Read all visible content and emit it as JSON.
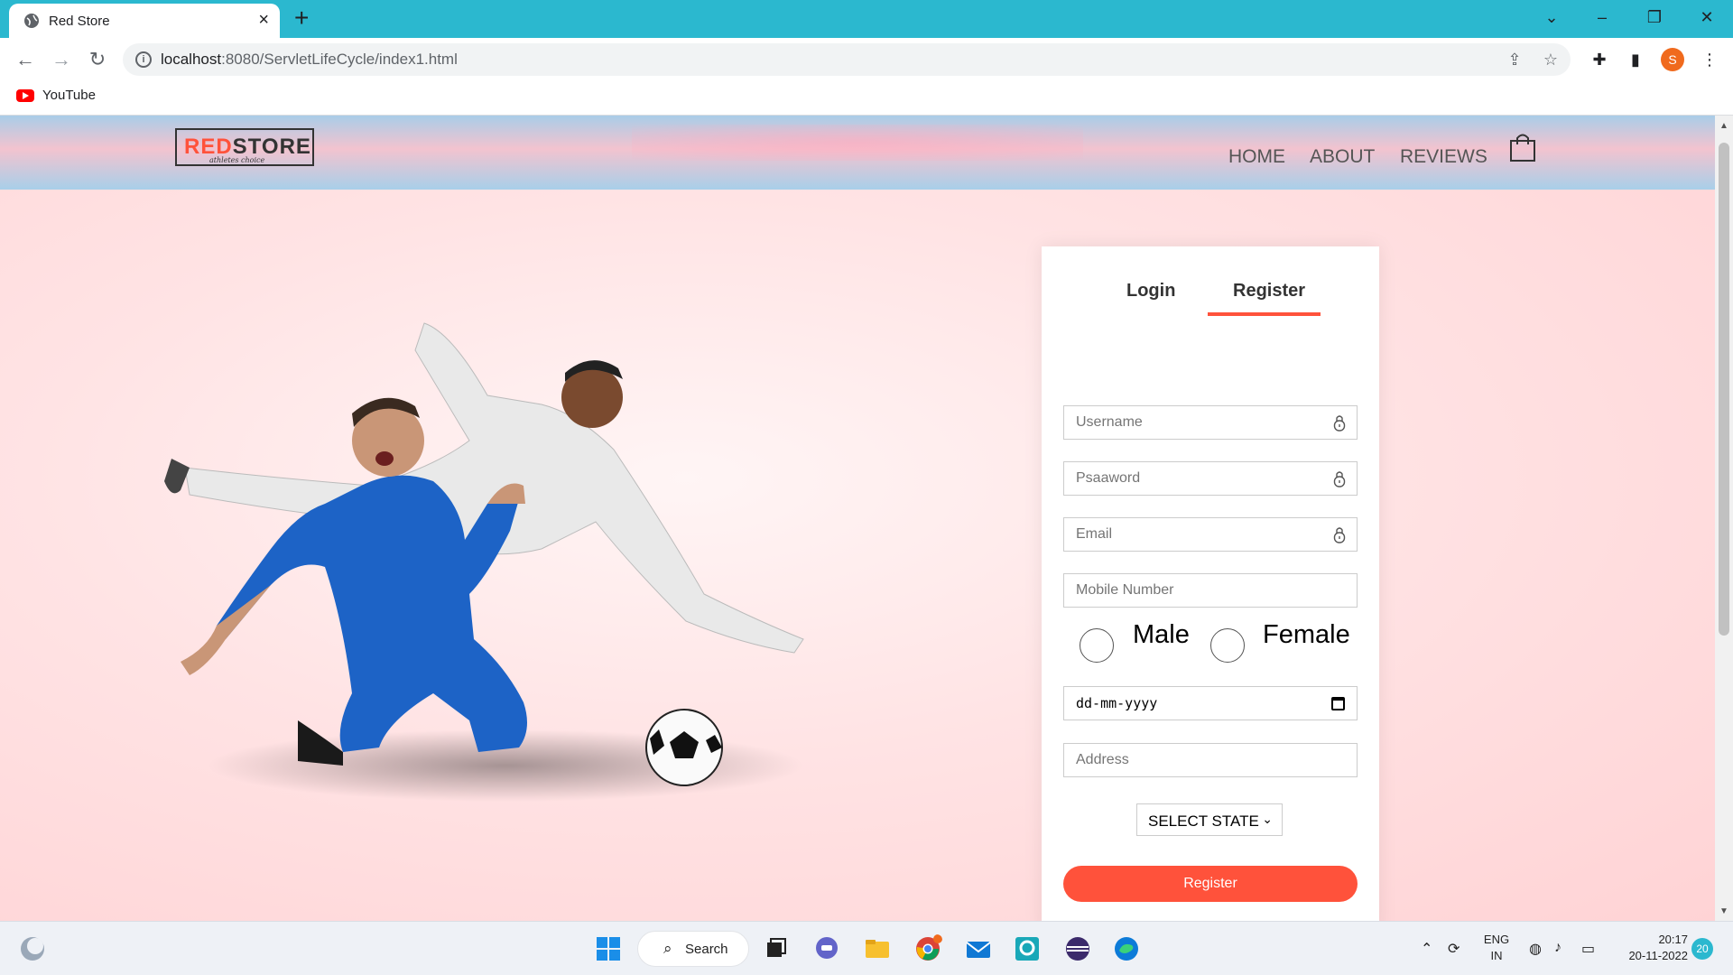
{
  "browser": {
    "tab_title": "Red Store",
    "url_host": "localhost",
    "url_path": ":8080/ServletLifeCycle/index1.html",
    "bookmark": "YouTube",
    "profile_initial": "S"
  },
  "site": {
    "logo": {
      "brand_prefix": "RED",
      "brand_suffix": "STORE",
      "tagline": "athletes choice"
    },
    "nav": {
      "home": "HOME",
      "about": "ABOUT",
      "reviews": "REVIEWS"
    },
    "accent_color": "#ff523b"
  },
  "form": {
    "tabs": {
      "login": "Login",
      "register": "Register"
    },
    "active_tab": "Register",
    "username_placeholder": "Username",
    "password_placeholder": "Psaaword",
    "email_placeholder": "Email",
    "mobile_placeholder": "Mobile Number",
    "gender": {
      "male": "Male",
      "female": "Female"
    },
    "date_placeholder": "dd-mm-yyyy",
    "address_placeholder": "Address",
    "state_select": "SELECT STATE",
    "submit": "Register"
  },
  "taskbar": {
    "search_label": "Search",
    "lang_top": "ENG",
    "lang_bottom": "IN",
    "time": "20:17",
    "date": "20-11-2022",
    "notification_count": "20"
  }
}
